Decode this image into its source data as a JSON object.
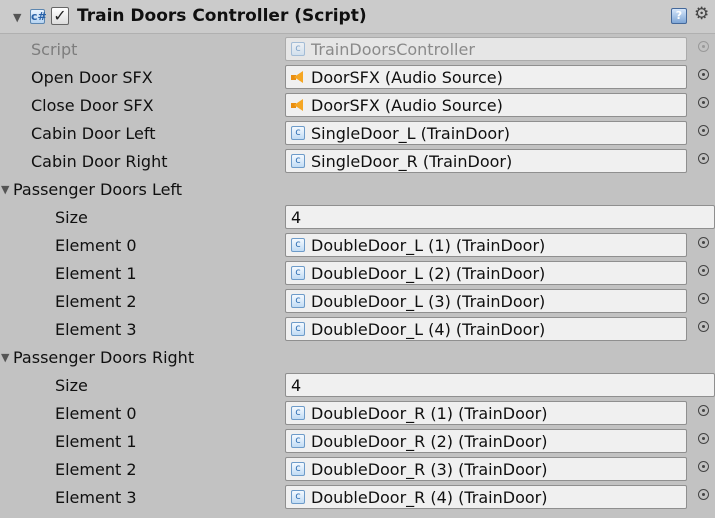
{
  "component": {
    "title": "Train Doors Controller (Script)",
    "enabled": "✓"
  },
  "fields": {
    "script": {
      "label": "Script",
      "value": "TrainDoorsController"
    },
    "open_door_sfx": {
      "label": "Open Door SFX",
      "value": "DoorSFX (Audio Source)"
    },
    "close_door_sfx": {
      "label": "Close Door SFX",
      "value": "DoorSFX (Audio Source)"
    },
    "cabin_door_left": {
      "label": "Cabin Door Left",
      "value": "SingleDoor_L (TrainDoor)"
    },
    "cabin_door_right": {
      "label": "Cabin Door Right",
      "value": "SingleDoor_R (TrainDoor)"
    }
  },
  "passenger_doors_left": {
    "label": "Passenger Doors Left",
    "size_label": "Size",
    "size": "4",
    "elements": [
      {
        "label": "Element 0",
        "value": "DoubleDoor_L (1) (TrainDoor)"
      },
      {
        "label": "Element 1",
        "value": "DoubleDoor_L (2) (TrainDoor)"
      },
      {
        "label": "Element 2",
        "value": "DoubleDoor_L (3) (TrainDoor)"
      },
      {
        "label": "Element 3",
        "value": "DoubleDoor_L (4) (TrainDoor)"
      }
    ]
  },
  "passenger_doors_right": {
    "label": "Passenger Doors Right",
    "size_label": "Size",
    "size": "4",
    "elements": [
      {
        "label": "Element 0",
        "value": "DoubleDoor_R (1) (TrainDoor)"
      },
      {
        "label": "Element 1",
        "value": "DoubleDoor_R (2) (TrainDoor)"
      },
      {
        "label": "Element 2",
        "value": "DoubleDoor_R (3) (TrainDoor)"
      },
      {
        "label": "Element 3",
        "value": "DoubleDoor_R (4) (TrainDoor)"
      }
    ]
  },
  "icons": {
    "foldout": "▼",
    "script_badge": "c#",
    "help": "?",
    "gear": "⚙",
    "object_field": "c"
  },
  "colors": {
    "panel_bg": "#c2c2c2",
    "field_bg": "#f0f0f0",
    "audio_icon": "#f5a623",
    "script_icon": "#2f6fb3"
  }
}
